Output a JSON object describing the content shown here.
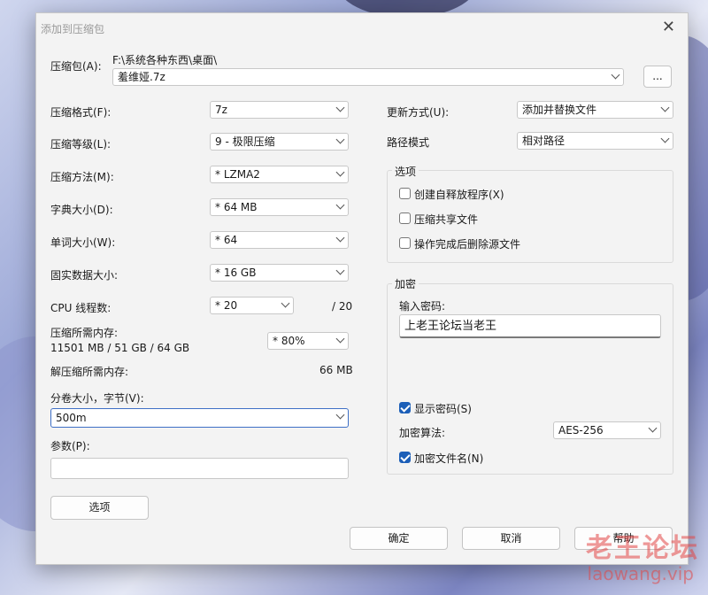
{
  "window": {
    "title": "添加到压缩包",
    "close_glyph": "✕"
  },
  "archive": {
    "label": "压缩包(A):",
    "path": "F:\\系统各种东西\\桌面\\",
    "filename": "羞维娅.7z",
    "browse_label": "..."
  },
  "left": {
    "format": {
      "label": "压缩格式(F):",
      "value": "7z"
    },
    "level": {
      "label": "压缩等级(L):",
      "value": "9 - 极限压缩"
    },
    "method": {
      "label": "压缩方法(M):",
      "value": "* LZMA2"
    },
    "dict": {
      "label": "字典大小(D):",
      "value": "* 64 MB"
    },
    "word": {
      "label": "单词大小(W):",
      "value": "* 64"
    },
    "solid": {
      "label": "固实数据大小:",
      "value": "* 16 GB"
    },
    "threads": {
      "label": "CPU 线程数:",
      "value": "* 20",
      "max": "/ 20"
    },
    "mem": {
      "label": "压缩所需内存:",
      "detail": "11501 MB / 51 GB / 64 GB",
      "value": "* 80%"
    },
    "decomp": {
      "label": "解压缩所需内存:",
      "value": "66 MB"
    },
    "volume": {
      "label": "分卷大小，字节(V):",
      "value": "500m"
    },
    "params": {
      "label": "参数(P):",
      "value": ""
    },
    "options_button": "选项"
  },
  "right": {
    "update": {
      "label": "更新方式(U):",
      "value": "添加并替换文件"
    },
    "path_mode": {
      "label": "路径模式",
      "value": "相对路径"
    },
    "options_group": {
      "title": "选项",
      "sfx": {
        "label": "创建自释放程序(X)",
        "checked": false
      },
      "shared": {
        "label": "压缩共享文件",
        "checked": false
      },
      "delete": {
        "label": "操作完成后删除源文件",
        "checked": false
      }
    },
    "encrypt_group": {
      "title": "加密",
      "password_label": "输入密码:",
      "password_value": "上老王论坛当老王",
      "show_password": {
        "label": "显示密码(S)",
        "checked": true
      },
      "method_label": "加密算法:",
      "method_value": "AES-256",
      "encrypt_names": {
        "label": "加密文件名(N)",
        "checked": true
      }
    }
  },
  "buttons": {
    "ok": "确定",
    "cancel": "取消",
    "help": "帮助"
  },
  "watermark": {
    "line1": "老王论坛",
    "line2": "laowang.vip"
  },
  "colors": {
    "accent": "#1c5fb8",
    "dialog_bg": "#f3f3f3"
  }
}
